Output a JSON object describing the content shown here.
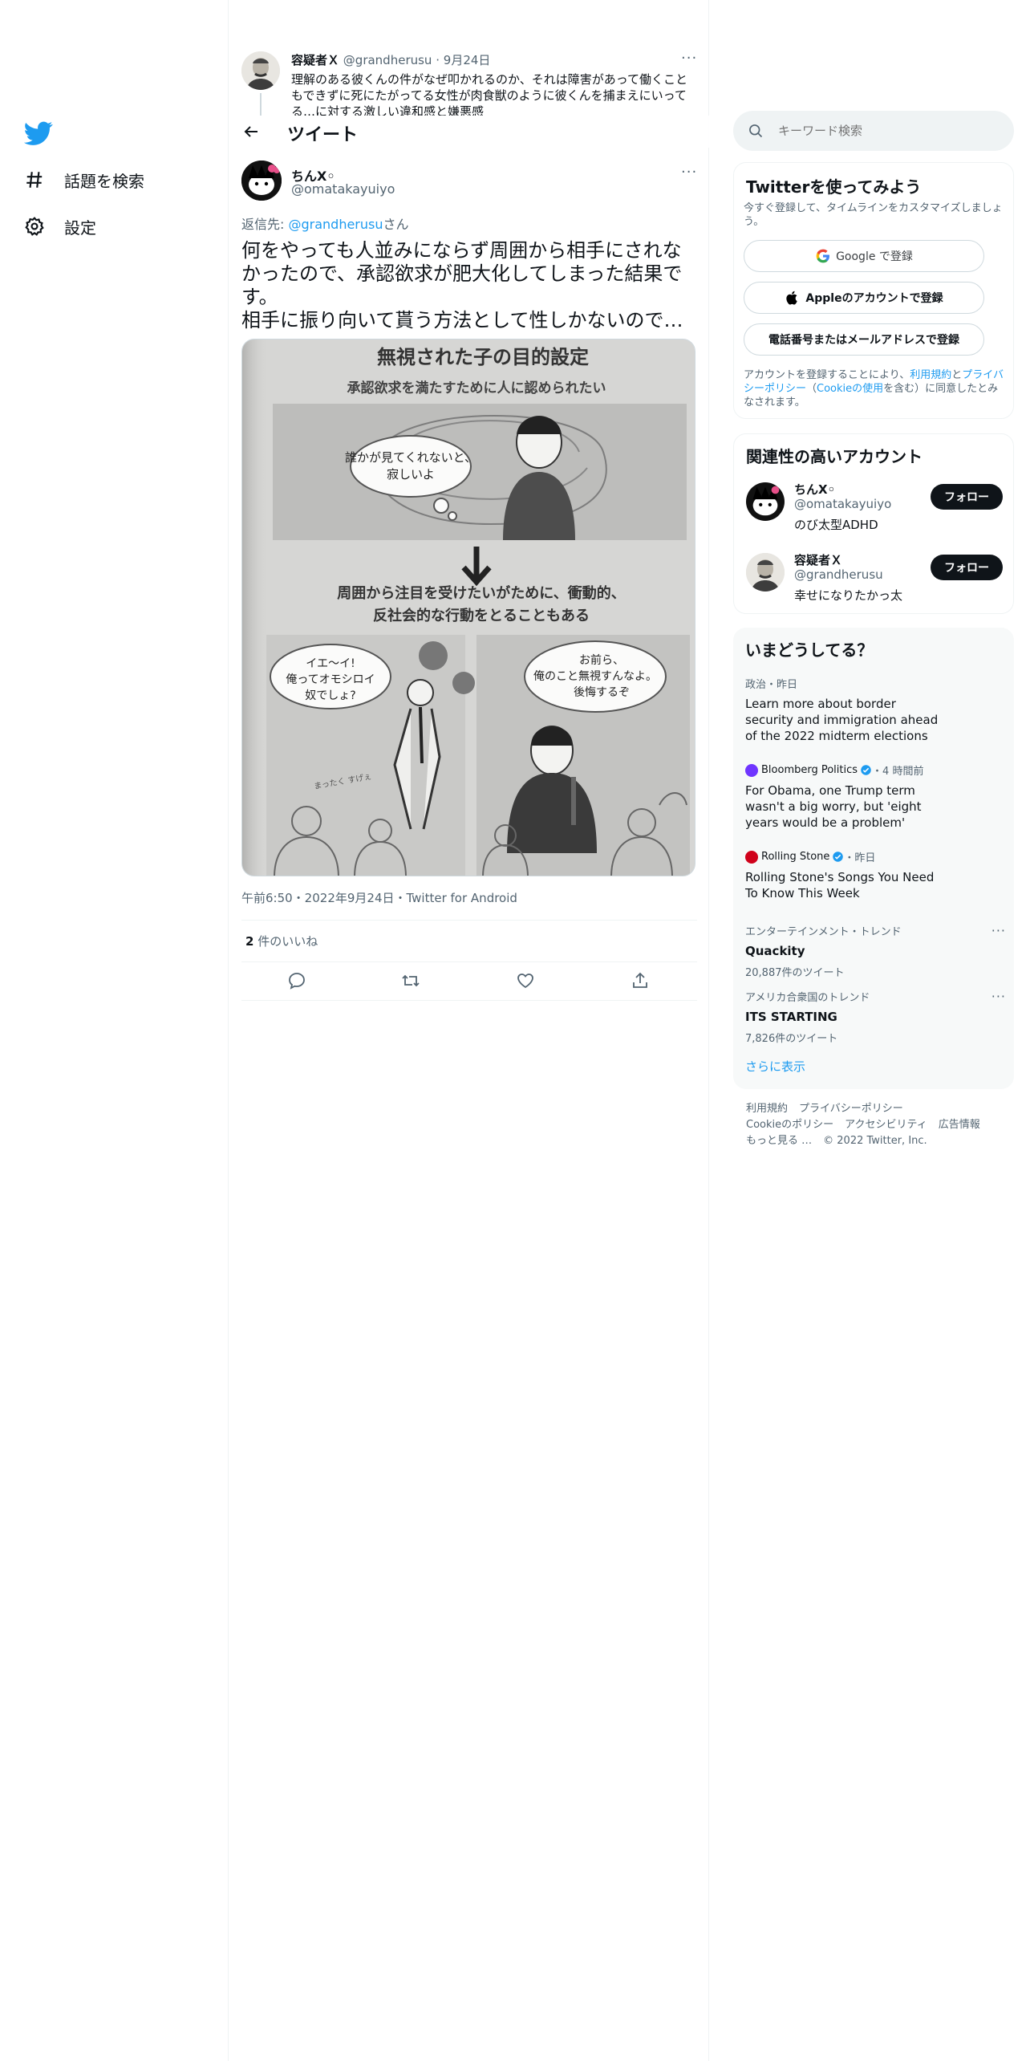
{
  "left_nav": {
    "items": [
      {
        "label": "話題を検索",
        "icon": "hashtag-icon"
      },
      {
        "label": "設定",
        "icon": "gear-icon"
      }
    ]
  },
  "previous_tweet": {
    "name": "容疑者Ｘ",
    "handle": "@grandherusu",
    "date": "9月24日",
    "text": "理解のある彼くんの件がなぜ叩かれるのか、それは障害があって働くこともできずに死にたがってる女性が肉食獣のように彼くんを捕まえにいってる…に対する激しい違和感と嫌悪感"
  },
  "topbar": {
    "title": "ツイート"
  },
  "tweet": {
    "name": "ちんX◦",
    "handle": "@omatakayuiyo",
    "reply_prefix": "返信先: ",
    "reply_to": "@grandherusu",
    "reply_suffix": "さん",
    "text": "何をやっても人並みにならず周囲から相手にされなかったので、承認欲求が肥大化してしまった結果です。\n相手に振り向いて貰う方法として性しかないので…",
    "image": {
      "title": "無視された子の目的設定",
      "subtitle": "承認欲求を満たすために人に認められたい",
      "bubble_top": "誰かが見てくれないと、寂しいよ",
      "middle_line1": "周囲から注目を受けたいがために、衝動的、",
      "middle_line2": "反社会的な行動をとることもある",
      "bubble_left": "イエ〜イ!\n俺ってオモシロイ\n奴でしょ?",
      "bubble_right": "お前ら、\n俺のこと無視すんなよ。\n後悔するぞ",
      "scribble": "まったく すげぇ"
    },
    "timestamp": "午前6:50・2022年9月24日・Twitter for Android",
    "likes_count": "2",
    "likes_label": " 件のいいね"
  },
  "search": {
    "placeholder": "キーワード検索"
  },
  "signup": {
    "title": "Twitterを使ってみよう",
    "subtitle": "今すぐ登録して、タイムラインをカスタマイズしましょう。",
    "google_label": "Google で登録",
    "apple_label": "Appleのアカウントで登録",
    "phone_label": "電話番号またはメールアドレスで登録",
    "terms_prefix": "アカウントを登録することにより、",
    "terms_link1": "利用規約",
    "terms_and": "と",
    "terms_link2": "プライバシーポリシー",
    "terms_paren_open": "（",
    "terms_link3": "Cookieの使用",
    "terms_suffix": "を含む）に同意したとみなされます。"
  },
  "related": {
    "title": "関連性の高いアカウント",
    "accounts": [
      {
        "name": "ちんX◦",
        "handle": "@omatakayuiyo",
        "bio": "のび太型ADHD",
        "follow": "フォロー"
      },
      {
        "name": "容疑者Ｘ",
        "handle": "@grandherusu",
        "bio": "幸せになりたかっ太",
        "follow": "フォロー"
      }
    ]
  },
  "trends": {
    "title": "いまどうしてる？",
    "items": [
      {
        "meta": "政治・昨日",
        "title": "Learn more about border security and immigration ahead of the 2022 midterm elections"
      },
      {
        "source": "Bloomberg Politics",
        "time": "・4 時間前",
        "title": "For Obama, one Trump term wasn't a big worry, but 'eight years would be a problem'",
        "color": "#6f35ff"
      },
      {
        "source": "Rolling Stone",
        "time": "・昨日",
        "title": "Rolling Stone's Songs You Need To Know This Week",
        "color": "#d0021b"
      },
      {
        "meta": "エンターテインメント・トレンド",
        "title": "Quackity",
        "count": "20,887件のツイート"
      },
      {
        "meta": "アメリカ合衆国のトレンド",
        "title": "ITS STARTING",
        "count": "7,826件のツイート"
      }
    ],
    "show_more": "さらに表示"
  },
  "footer": {
    "links": [
      "利用規約",
      "プライバシーポリシー",
      "Cookieのポリシー",
      "アクセシビリティ",
      "広告情報",
      "もっと見る …"
    ],
    "copyright": "© 2022 Twitter, Inc."
  },
  "colors": {
    "accent": "#1d9bf0",
    "text": "#0f1419",
    "muted": "#536471",
    "border": "#eff3f4"
  }
}
